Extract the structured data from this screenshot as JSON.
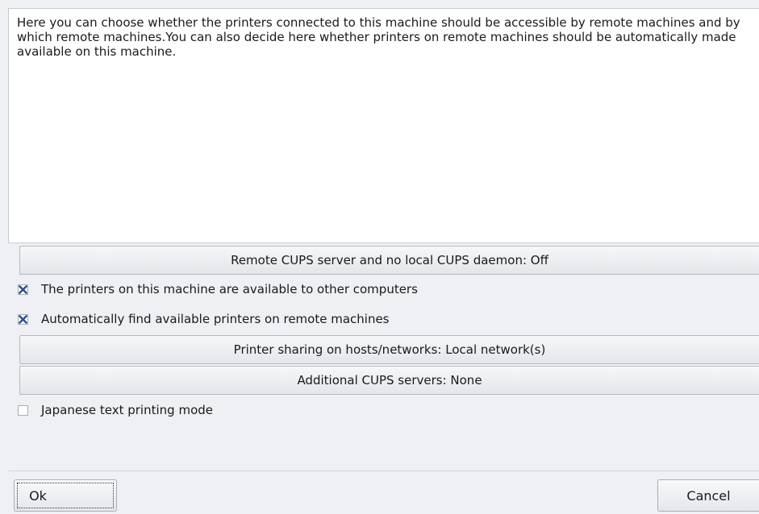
{
  "description": {
    "text": "Here you can choose whether the printers connected to this machine should be accessible by remote machines and by which remote machines.You can also decide here whether printers on remote machines should be automatically made available on this machine."
  },
  "buttons": {
    "remote_cups": "Remote CUPS server and no local CUPS daemon: Off",
    "printer_sharing": "Printer sharing on hosts/networks: Local network(s)",
    "additional_cups": "Additional CUPS servers: None"
  },
  "checkboxes": {
    "available_to_others": {
      "label": "The printers on this machine are available to other computers",
      "checked": true
    },
    "auto_find": {
      "label": "Automatically find available printers on remote machines",
      "checked": true
    },
    "japanese_mode": {
      "label": "Japanese text printing mode",
      "checked": false
    }
  },
  "dialog": {
    "ok_label": "Ok",
    "cancel_label": "Cancel"
  },
  "colors": {
    "check_mark": "#2a4f8f",
    "background": "#eef0f3"
  },
  "icons": {
    "check": "x-check-icon"
  }
}
